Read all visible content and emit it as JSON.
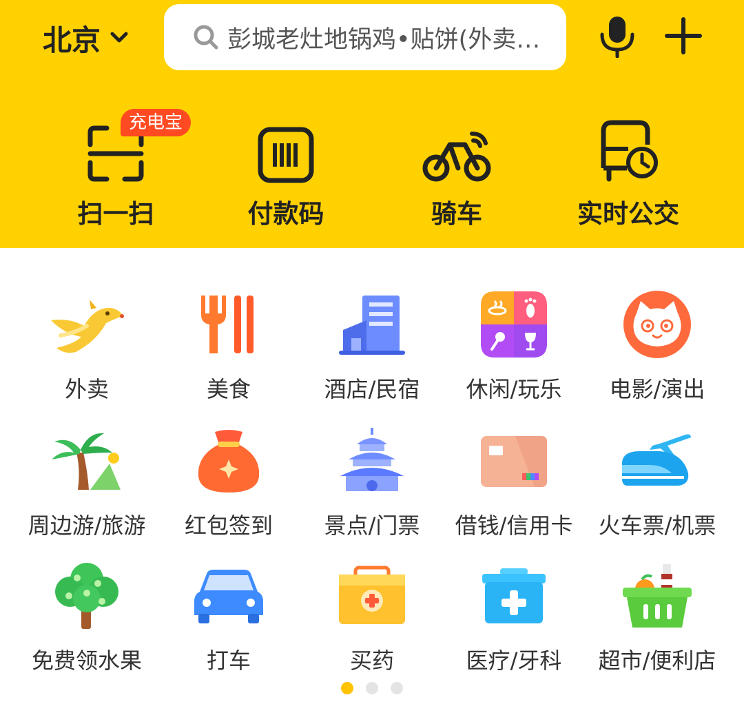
{
  "header": {
    "city": "北京",
    "search_placeholder": "彭城老灶地锅鸡•贴饼(外卖…",
    "accent_color": "#FFD100"
  },
  "quick_actions": [
    {
      "label": "扫一扫",
      "icon": "scan-icon",
      "badge": "充电宝"
    },
    {
      "label": "付款码",
      "icon": "barcode-icon"
    },
    {
      "label": "骑车",
      "icon": "bicycle-icon"
    },
    {
      "label": "实时公交",
      "icon": "bus-clock-icon"
    }
  ],
  "services": [
    {
      "label": "外卖",
      "icon": "kangaroo-icon"
    },
    {
      "label": "美食",
      "icon": "fork-chopsticks-icon"
    },
    {
      "label": "酒店/民宿",
      "icon": "hotel-building-icon"
    },
    {
      "label": "休闲/玩乐",
      "icon": "leisure-grid-icon"
    },
    {
      "label": "电影/演出",
      "icon": "cat-face-icon"
    },
    {
      "label": "周边游/旅游",
      "icon": "palm-tree-icon"
    },
    {
      "label": "红包签到",
      "icon": "red-envelope-bag-icon"
    },
    {
      "label": "景点/门票",
      "icon": "temple-icon"
    },
    {
      "label": "借钱/信用卡",
      "icon": "credit-card-icon"
    },
    {
      "label": "火车票/机票",
      "icon": "train-plane-icon"
    },
    {
      "label": "免费领水果",
      "icon": "fruit-tree-icon"
    },
    {
      "label": "打车",
      "icon": "car-icon"
    },
    {
      "label": "买药",
      "icon": "medicine-box-icon"
    },
    {
      "label": "医疗/牙科",
      "icon": "medical-kit-icon"
    },
    {
      "label": "超市/便利店",
      "icon": "shopping-basket-icon"
    }
  ],
  "pagination": {
    "total": 3,
    "active": 1
  }
}
